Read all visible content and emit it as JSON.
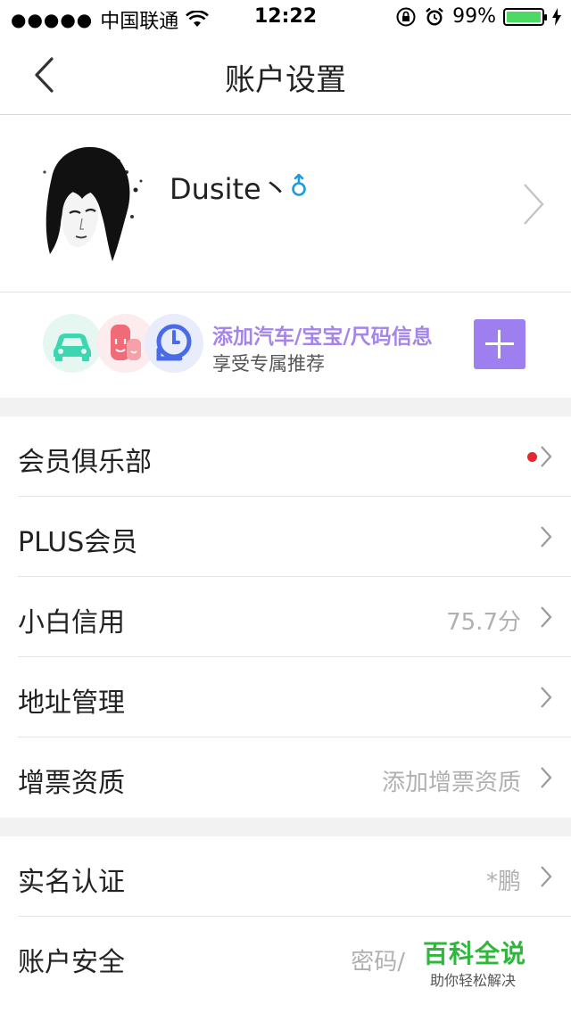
{
  "status_bar": {
    "signal_dots": "●●●●●",
    "carrier": "中国联通",
    "time": "12:22",
    "battery_percent": "99%",
    "battery_level": 0.99,
    "icons": [
      "signal-dots-icon",
      "wifi-icon",
      "rotation-lock-icon",
      "alarm-icon",
      "battery-icon",
      "charging-icon"
    ]
  },
  "nav": {
    "title": "账户设置",
    "back_icon": "chevron-left-icon"
  },
  "profile": {
    "username": "Dusite丶",
    "gender_icon": "male-icon",
    "gender_color": "#1e9be0"
  },
  "promo": {
    "title": "添加汽车/宝宝/尺码信息",
    "subtitle": "享受专属推荐",
    "icons": [
      "car-icon",
      "baby-icon",
      "measure-icon"
    ],
    "accent": "#9e7ff0"
  },
  "groups": [
    {
      "rows": [
        {
          "label": "会员俱乐部",
          "value": "",
          "badge": "red-dot"
        },
        {
          "label": "PLUS会员",
          "value": ""
        },
        {
          "label": "小白信用",
          "value": "75.7分"
        },
        {
          "label": "地址管理",
          "value": ""
        },
        {
          "label": "增票资质",
          "value": "添加增票资质"
        }
      ]
    },
    {
      "rows": [
        {
          "label": "实名认证",
          "value": "*鹏"
        },
        {
          "label": "账户安全",
          "value": "密码/"
        }
      ]
    }
  ],
  "watermark": {
    "title": "百科全说",
    "subtitle": "助你轻松解决"
  }
}
